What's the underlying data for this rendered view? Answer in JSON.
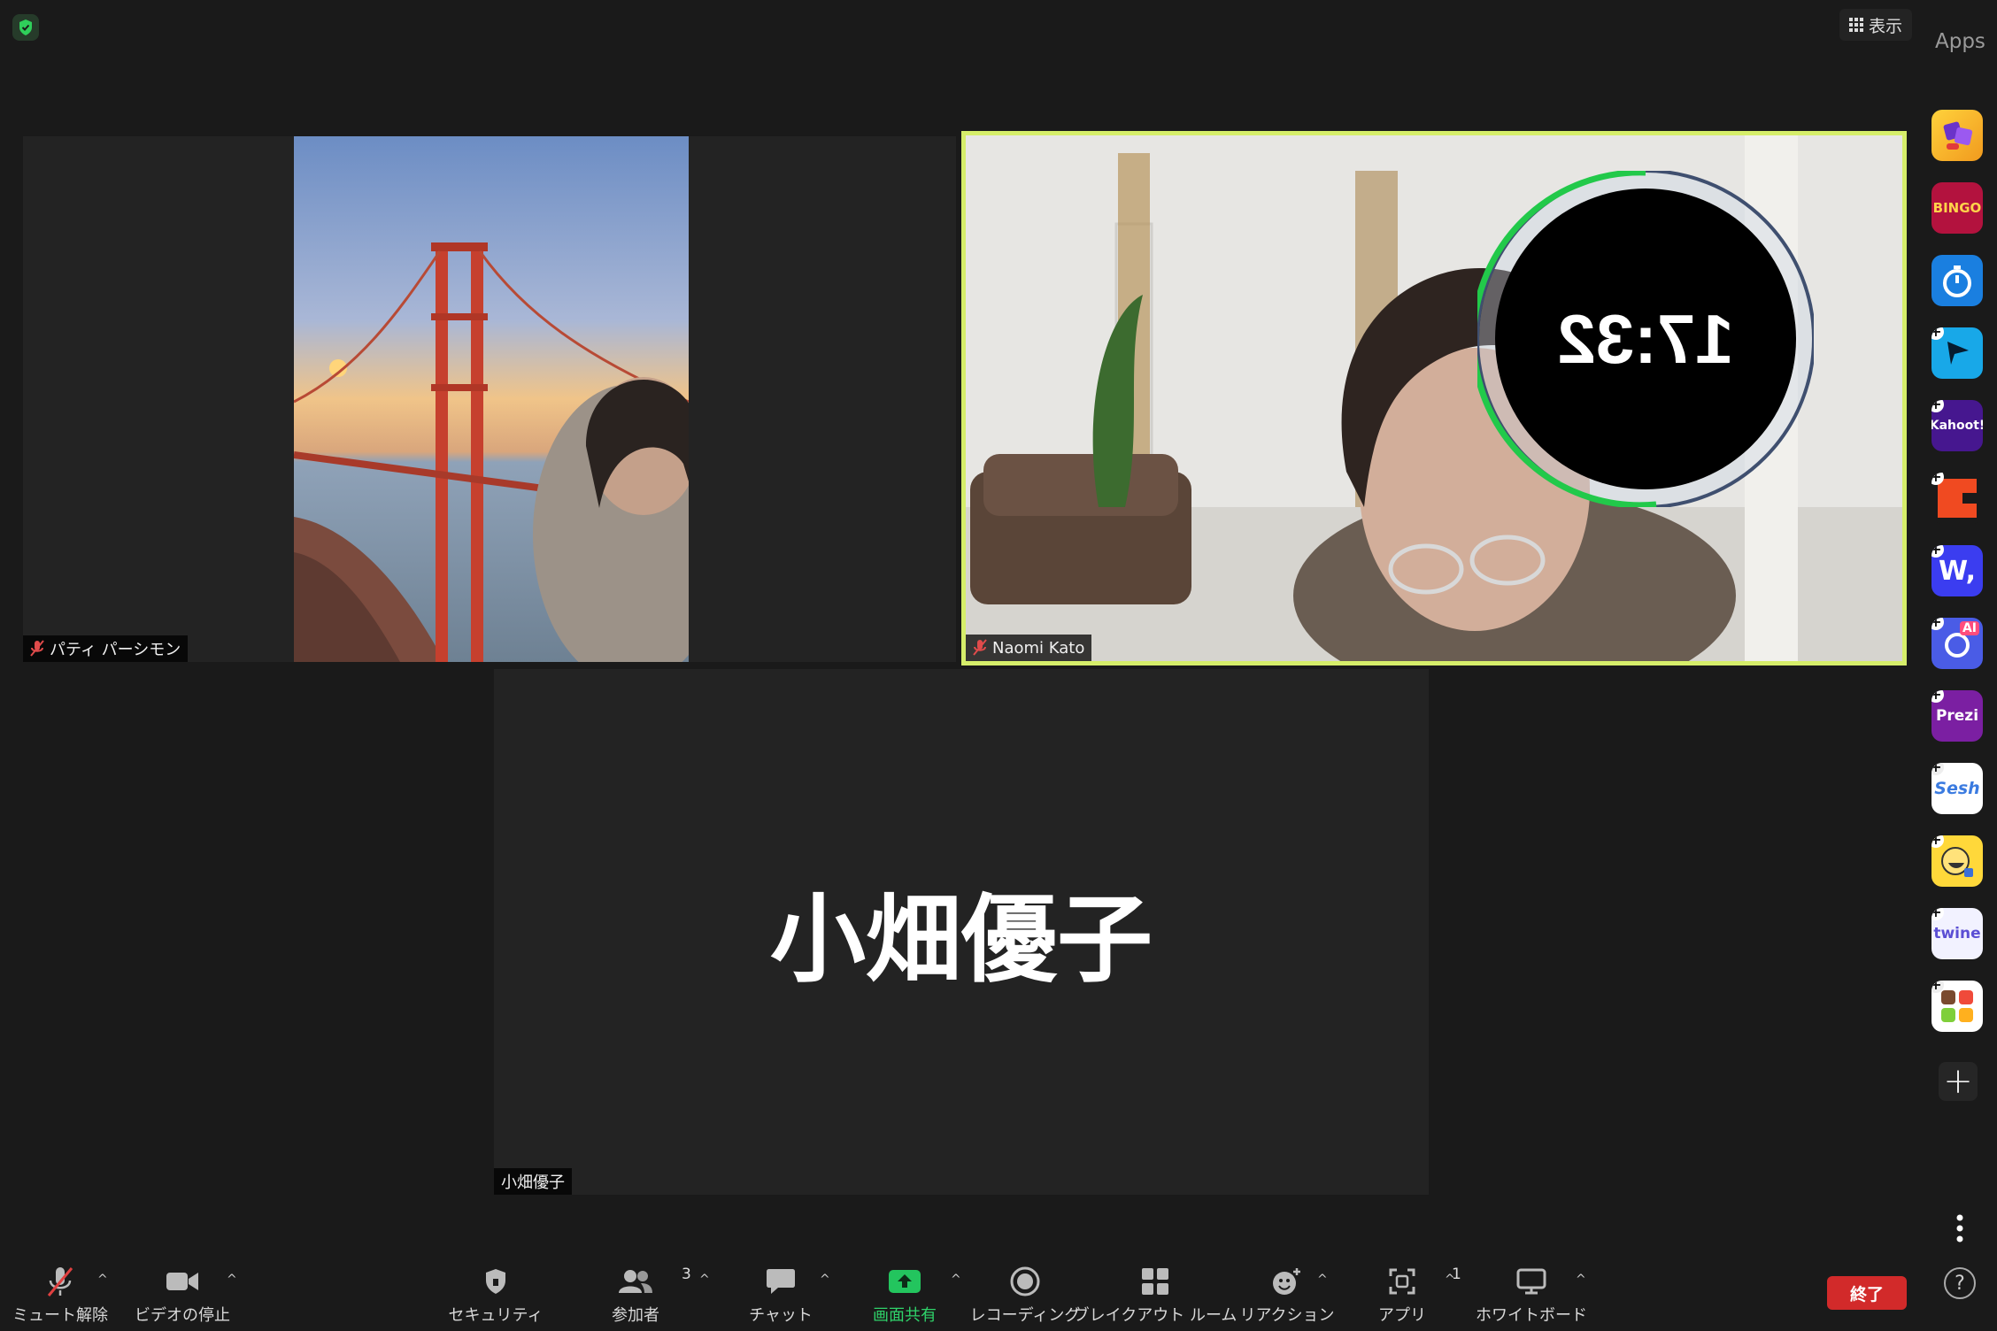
{
  "topbar": {
    "view_label": "表示",
    "apps_label": "Apps"
  },
  "participants": {
    "tile1": {
      "name": "パティ パーシモン"
    },
    "tile2": {
      "name": "Naomi Kato",
      "timer": "17:32"
    },
    "tile3": {
      "name": "小畑優子",
      "display_name": "小畑優子"
    }
  },
  "sidebar_apps": [
    {
      "icon": "dice-game-icon",
      "text": ""
    },
    {
      "icon": "bingo-icon",
      "text": "BINGO"
    },
    {
      "icon": "timer-app-icon",
      "text": ""
    },
    {
      "icon": "pitch-app-icon",
      "text": ""
    },
    {
      "icon": "kahoot-icon",
      "text": "Kahoot!"
    },
    {
      "icon": "orange-c-app-icon",
      "text": ""
    },
    {
      "icon": "wooclap-icon",
      "text": "W,"
    },
    {
      "icon": "ai-app-icon",
      "text": "AI"
    },
    {
      "icon": "prezi-icon",
      "text": "Prezi"
    },
    {
      "icon": "sesh-icon",
      "text": "Sesh"
    },
    {
      "icon": "emoji-app-icon",
      "text": ""
    },
    {
      "icon": "twine-icon",
      "text": "twine"
    },
    {
      "icon": "blocks-app-icon",
      "text": ""
    }
  ],
  "toolbar": {
    "mute": "ミュート解除",
    "video": "ビデオの停止",
    "security": "セキュリティ",
    "participants": "参加者",
    "participants_count": "3",
    "chat": "チャット",
    "share": "画面共有",
    "record": "レコーディング",
    "breakout": "ブレイクアウト ルーム",
    "reactions": "リアクション",
    "apps": "アプリ",
    "apps_count": "1",
    "whiteboard": "ホワイトボード",
    "end": "終了"
  },
  "colors": {
    "active_speaker": "#d6ee6a",
    "end_button": "#d22a2a",
    "share_green": "#23c55e"
  }
}
